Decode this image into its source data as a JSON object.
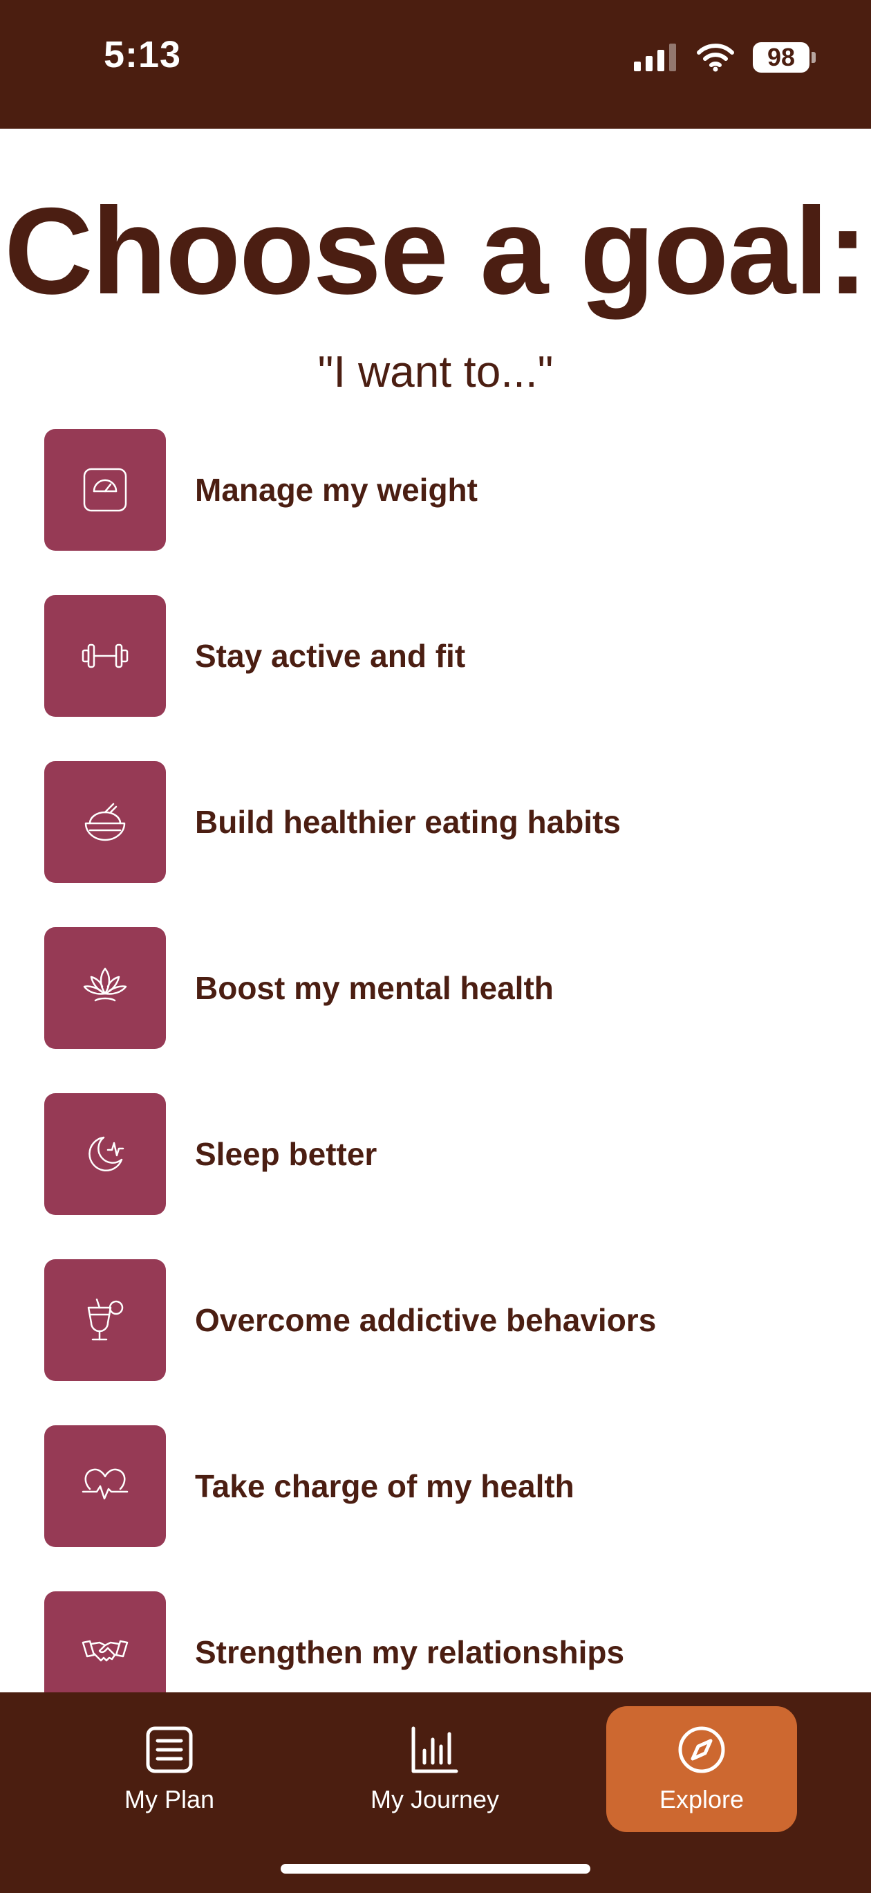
{
  "status_bar": {
    "time": "5:13",
    "battery": "98"
  },
  "title": "Choose a goal:",
  "subtitle": "\"I want to...\"",
  "goals": [
    {
      "label": "Manage my weight",
      "icon": "scale-icon"
    },
    {
      "label": "Stay active and fit",
      "icon": "dumbbell-icon"
    },
    {
      "label": "Build healthier eating habits",
      "icon": "food-bowl-icon"
    },
    {
      "label": "Boost my mental health",
      "icon": "lotus-icon"
    },
    {
      "label": "Sleep better",
      "icon": "moon-icon"
    },
    {
      "label": "Overcome addictive behaviors",
      "icon": "cocktail-icon"
    },
    {
      "label": "Take charge of my health",
      "icon": "heartbeat-icon"
    },
    {
      "label": "Strengthen my relationships",
      "icon": "handshake-icon"
    }
  ],
  "tabs": [
    {
      "label": "My Plan",
      "icon": "list-icon",
      "active": false
    },
    {
      "label": "My Journey",
      "icon": "bar-chart-icon",
      "active": false
    },
    {
      "label": "Explore",
      "icon": "compass-icon",
      "active": true
    }
  ],
  "colors": {
    "brand_dark": "#4b1e10",
    "tile": "#963a55",
    "active_tab": "#cd6830",
    "background": "#ffffff"
  }
}
